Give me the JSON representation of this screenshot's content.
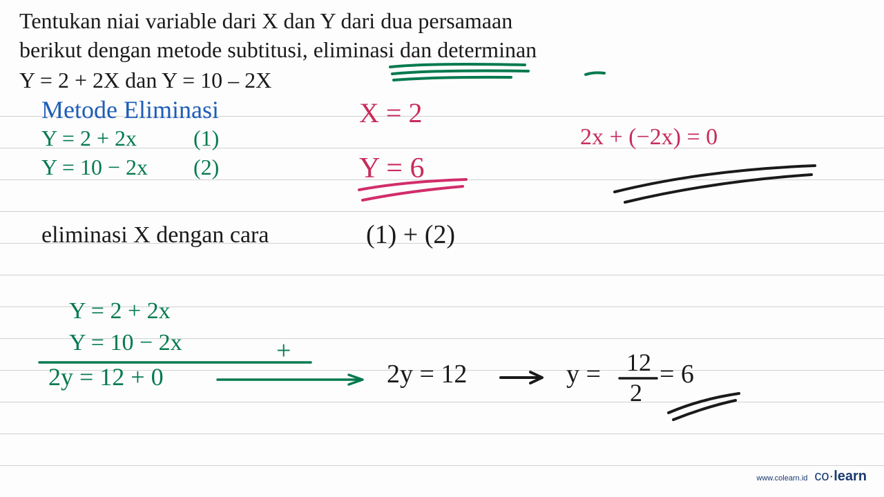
{
  "problem": {
    "line1": "Tentukan niai variable dari X dan Y dari dua persamaan",
    "line2": "berikut dengan metode subtitusi, eliminasi dan determinan",
    "line3": "Y = 2 + 2X dan Y = 10 – 2X"
  },
  "work": {
    "method_title": "Metode  Eliminasi",
    "eq1": "Y = 2 + 2x",
    "eq1_label": "(1)",
    "eq2": "Y = 10 − 2x",
    "eq2_label": "(2)",
    "answer_x": "X = 2",
    "answer_y": "Y = 6",
    "check_expr": "2x + (−2x) = 0",
    "step_text_a": "eliminasi  X  dengan  cara",
    "step_text_b": "(1) + (2)",
    "calc_eq1": "Y = 2 + 2x",
    "calc_eq2": "Y  = 10 − 2x",
    "calc_plus": "+",
    "calc_sum": "2y = 12 + 0",
    "calc_result_a": "2y = 12",
    "calc_result_b": "y = ",
    "calc_frac_top": "12",
    "calc_frac_bot": "2",
    "calc_result_c": " = 6"
  },
  "branding": {
    "url": "www.colearn.id",
    "logo_prefix": "co",
    "logo_dot": "·",
    "logo_suffix": "learn"
  }
}
